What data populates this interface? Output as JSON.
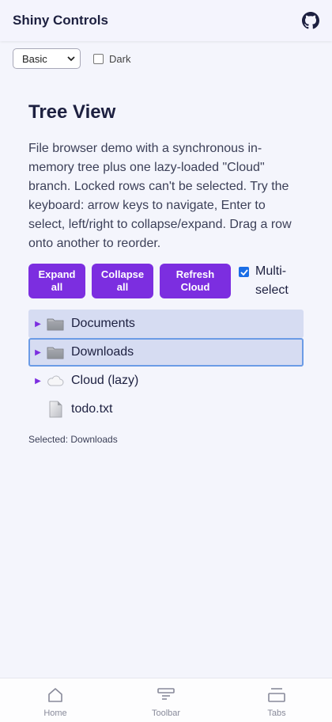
{
  "header": {
    "title": "Shiny Controls",
    "github_icon": "github-icon"
  },
  "controls": {
    "theme_select": {
      "value": "Basic",
      "options": [
        "Basic"
      ]
    },
    "dark_label": "Dark",
    "dark_checked": false
  },
  "main": {
    "title": "Tree View",
    "description": "File browser demo with a synchronous in-memory tree plus one lazy-loaded \"Cloud\" branch. Locked rows can't be selected. Try the keyboard: arrow keys to navigate, Enter to select, left/right to collapse/expand. Drag a row onto another to reorder."
  },
  "buttons": {
    "expand_all": "Expand all",
    "collapse_all": "Collapse all",
    "refresh_cloud": "Refresh Cloud",
    "multi_select_label": "Multi-select",
    "multi_select_checked": true
  },
  "tree": {
    "rows": [
      {
        "label": "Documents",
        "icon": "folder-icon",
        "expandable": true,
        "state": "highlight"
      },
      {
        "label": "Downloads",
        "icon": "folder-icon",
        "expandable": true,
        "state": "selected"
      },
      {
        "label": "Cloud (lazy)",
        "icon": "cloud-icon",
        "expandable": true,
        "state": "none"
      },
      {
        "label": "todo.txt",
        "icon": "file-icon",
        "expandable": false,
        "state": "none"
      }
    ],
    "selected_text": "Selected: Downloads"
  },
  "nav": {
    "items": [
      {
        "label": "Home",
        "icon": "home-icon"
      },
      {
        "label": "Toolbar",
        "icon": "toolbar-icon"
      },
      {
        "label": "Tabs",
        "icon": "tabs-icon"
      }
    ]
  },
  "colors": {
    "accent": "#7c2ee0",
    "selection_bg": "#d6dcf2",
    "selection_border": "#6b9be6",
    "checkbox": "#1a6ee6"
  }
}
